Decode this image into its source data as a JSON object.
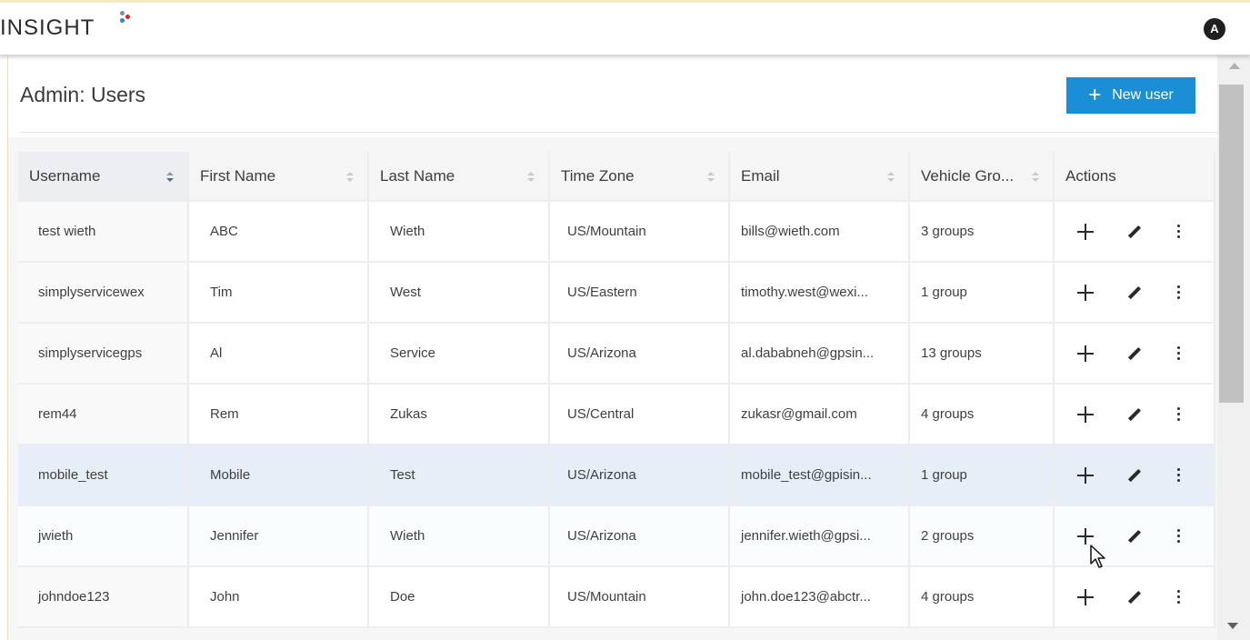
{
  "app": {
    "logo_text": "INSIGHT",
    "logo_dot_colors": [
      "#7d8ea8",
      "#d9252b",
      "#3b7dd8"
    ],
    "avatar_initial": "A"
  },
  "page": {
    "title": "Admin: Users",
    "new_user_label": "New user",
    "accent_color": "#1a8fd6"
  },
  "table": {
    "columns": [
      {
        "label": "Username",
        "sort": "active"
      },
      {
        "label": "First Name",
        "sort": "none"
      },
      {
        "label": "Last Name",
        "sort": "none"
      },
      {
        "label": "Time Zone",
        "sort": "none"
      },
      {
        "label": "Email",
        "sort": "none"
      },
      {
        "label": "Vehicle Gro...",
        "sort": "none"
      },
      {
        "label": "Actions",
        "sort": null
      }
    ],
    "rows": [
      {
        "username": "test wieth",
        "first_name": "ABC",
        "last_name": "Wieth",
        "time_zone": "US/Mountain",
        "email": "bills@wieth.com",
        "vehicle_groups": "3 groups"
      },
      {
        "username": "simplyservicewex",
        "first_name": "Tim",
        "last_name": "West",
        "time_zone": "US/Eastern",
        "email": "timothy.west@wexi...",
        "vehicle_groups": "1 group"
      },
      {
        "username": "simplyservicegps",
        "first_name": "Al",
        "last_name": "Service",
        "time_zone": "US/Arizona",
        "email": "al.dababneh@gpsin...",
        "vehicle_groups": "13 groups"
      },
      {
        "username": "rem44",
        "first_name": "Rem",
        "last_name": "Zukas",
        "time_zone": "US/Central",
        "email": "zukasr@gmail.com",
        "vehicle_groups": "4 groups"
      },
      {
        "username": "mobile_test",
        "first_name": "Mobile",
        "last_name": "Test",
        "time_zone": "US/Arizona",
        "email": "mobile_test@gpisin...",
        "vehicle_groups": "1 group",
        "selected": true
      },
      {
        "username": "jwieth",
        "first_name": "Jennifer",
        "last_name": "Wieth",
        "time_zone": "US/Arizona",
        "email": "jennifer.wieth@gpsi...",
        "vehicle_groups": "2 groups",
        "hovered": true
      },
      {
        "username": "johndoe123",
        "first_name": "John",
        "last_name": "Doe",
        "time_zone": "US/Mountain",
        "email": "john.doe123@abctr...",
        "vehicle_groups": "4 groups"
      }
    ],
    "row_actions": [
      "plus-icon",
      "pencil-icon",
      "more-vertical-icon"
    ]
  }
}
